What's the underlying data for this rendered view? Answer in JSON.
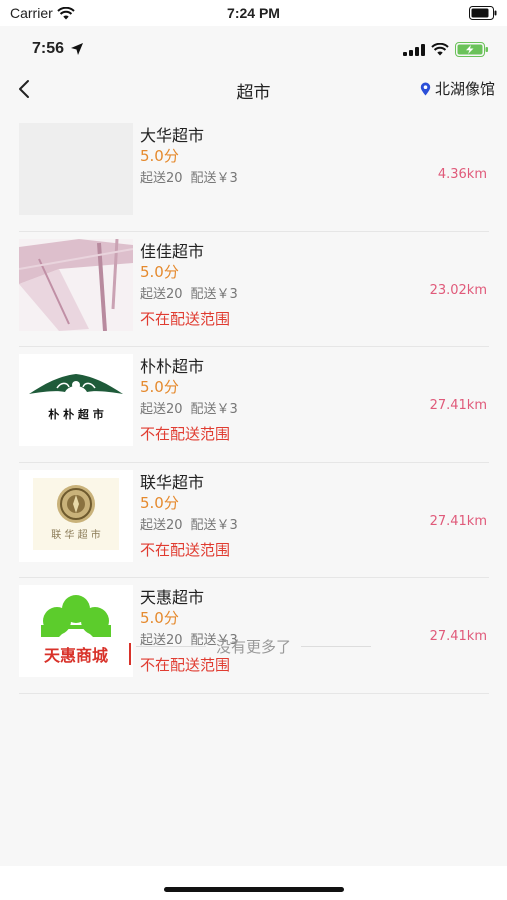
{
  "sim_status": {
    "carrier": "Carrier",
    "time": "7:24 PM"
  },
  "device_status": {
    "time": "7:56"
  },
  "nav": {
    "title": "超市",
    "location": "北湖像馆"
  },
  "stores": [
    {
      "name": "大华超市",
      "score": "5.0分",
      "min_order": "起送20",
      "delivery_fee": "配送￥3",
      "distance": "4.36km",
      "status": ""
    },
    {
      "name": "佳佳超市",
      "score": "5.0分",
      "min_order": "起送20",
      "delivery_fee": "配送￥3",
      "distance": "23.02km",
      "status": "不在配送范围"
    },
    {
      "name": "朴朴超市",
      "score": "5.0分",
      "min_order": "起送20",
      "delivery_fee": "配送￥3",
      "distance": "27.41km",
      "status": "不在配送范围",
      "logo_text": "朴 朴 超 市"
    },
    {
      "name": "联华超市",
      "score": "5.0分",
      "min_order": "起送20",
      "delivery_fee": "配送￥3",
      "distance": "27.41km",
      "status": "不在配送范围",
      "logo_text": "联 华 超 市"
    },
    {
      "name": "天惠超市",
      "score": "5.0分",
      "min_order": "起送20",
      "delivery_fee": "配送￥3",
      "distance": "27.41km",
      "status": "不在配送范围",
      "logo_text": "天惠商城"
    }
  ],
  "footer": {
    "text": "没有更多了"
  },
  "colors": {
    "score": "#e58a2e",
    "distance": "#e05a7a",
    "out_of_range": "#e03c31",
    "background": "#f7f7f7"
  }
}
